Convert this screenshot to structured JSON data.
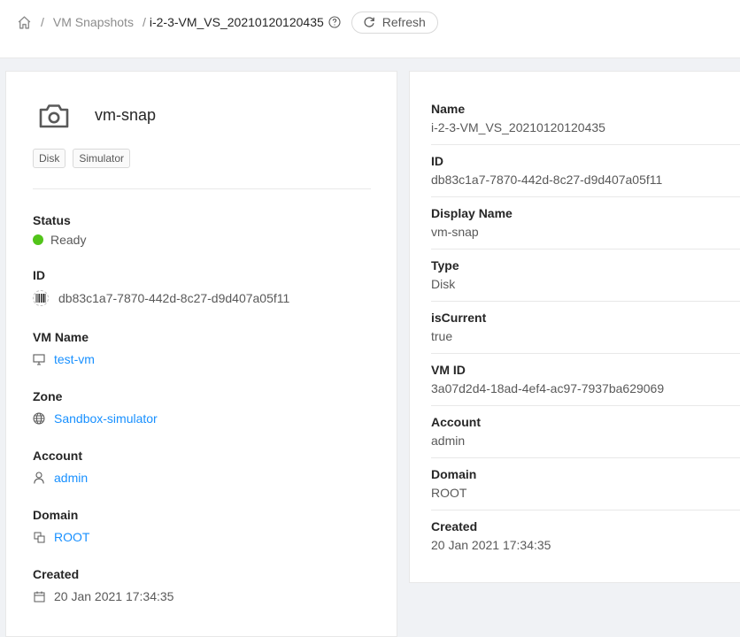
{
  "breadcrumb": {
    "home_icon": "home-icon",
    "sep1": "/",
    "section": "VM Snapshots",
    "sep2": "/",
    "current": "i-2-3-VM_VS_20210120120435",
    "help_icon": "question-circle-icon"
  },
  "toolbar": {
    "refresh_label": "Refresh",
    "refresh_icon": "reload-icon"
  },
  "summary": {
    "icon": "camera-icon",
    "name": "vm-snap",
    "tags": [
      "Disk",
      "Simulator"
    ],
    "status_label": "Status",
    "status_value": "Ready",
    "status_color": "#52c41a",
    "id_label": "ID",
    "id_value": "db83c1a7-7870-442d-8c27-d9d407a05f11",
    "vmname_label": "VM Name",
    "vmname_value": "test-vm",
    "zone_label": "Zone",
    "zone_value": "Sandbox-simulator",
    "account_label": "Account",
    "account_value": "admin",
    "domain_label": "Domain",
    "domain_value": "ROOT",
    "created_label": "Created",
    "created_value": "20 Jan 2021 17:34:35"
  },
  "details": [
    {
      "label": "Name",
      "value": "i-2-3-VM_VS_20210120120435"
    },
    {
      "label": "ID",
      "value": "db83c1a7-7870-442d-8c27-d9d407a05f11"
    },
    {
      "label": "Display Name",
      "value": "vm-snap"
    },
    {
      "label": "Type",
      "value": "Disk"
    },
    {
      "label": "isCurrent",
      "value": "true"
    },
    {
      "label": "VM ID",
      "value": "3a07d2d4-18ad-4ef4-ac97-7937ba629069"
    },
    {
      "label": "Account",
      "value": "admin"
    },
    {
      "label": "Domain",
      "value": "ROOT"
    },
    {
      "label": "Created",
      "value": "20 Jan 2021 17:34:35"
    }
  ],
  "colors": {
    "link": "#1890ff",
    "ready": "#52c41a",
    "background": "#f0f2f5"
  }
}
